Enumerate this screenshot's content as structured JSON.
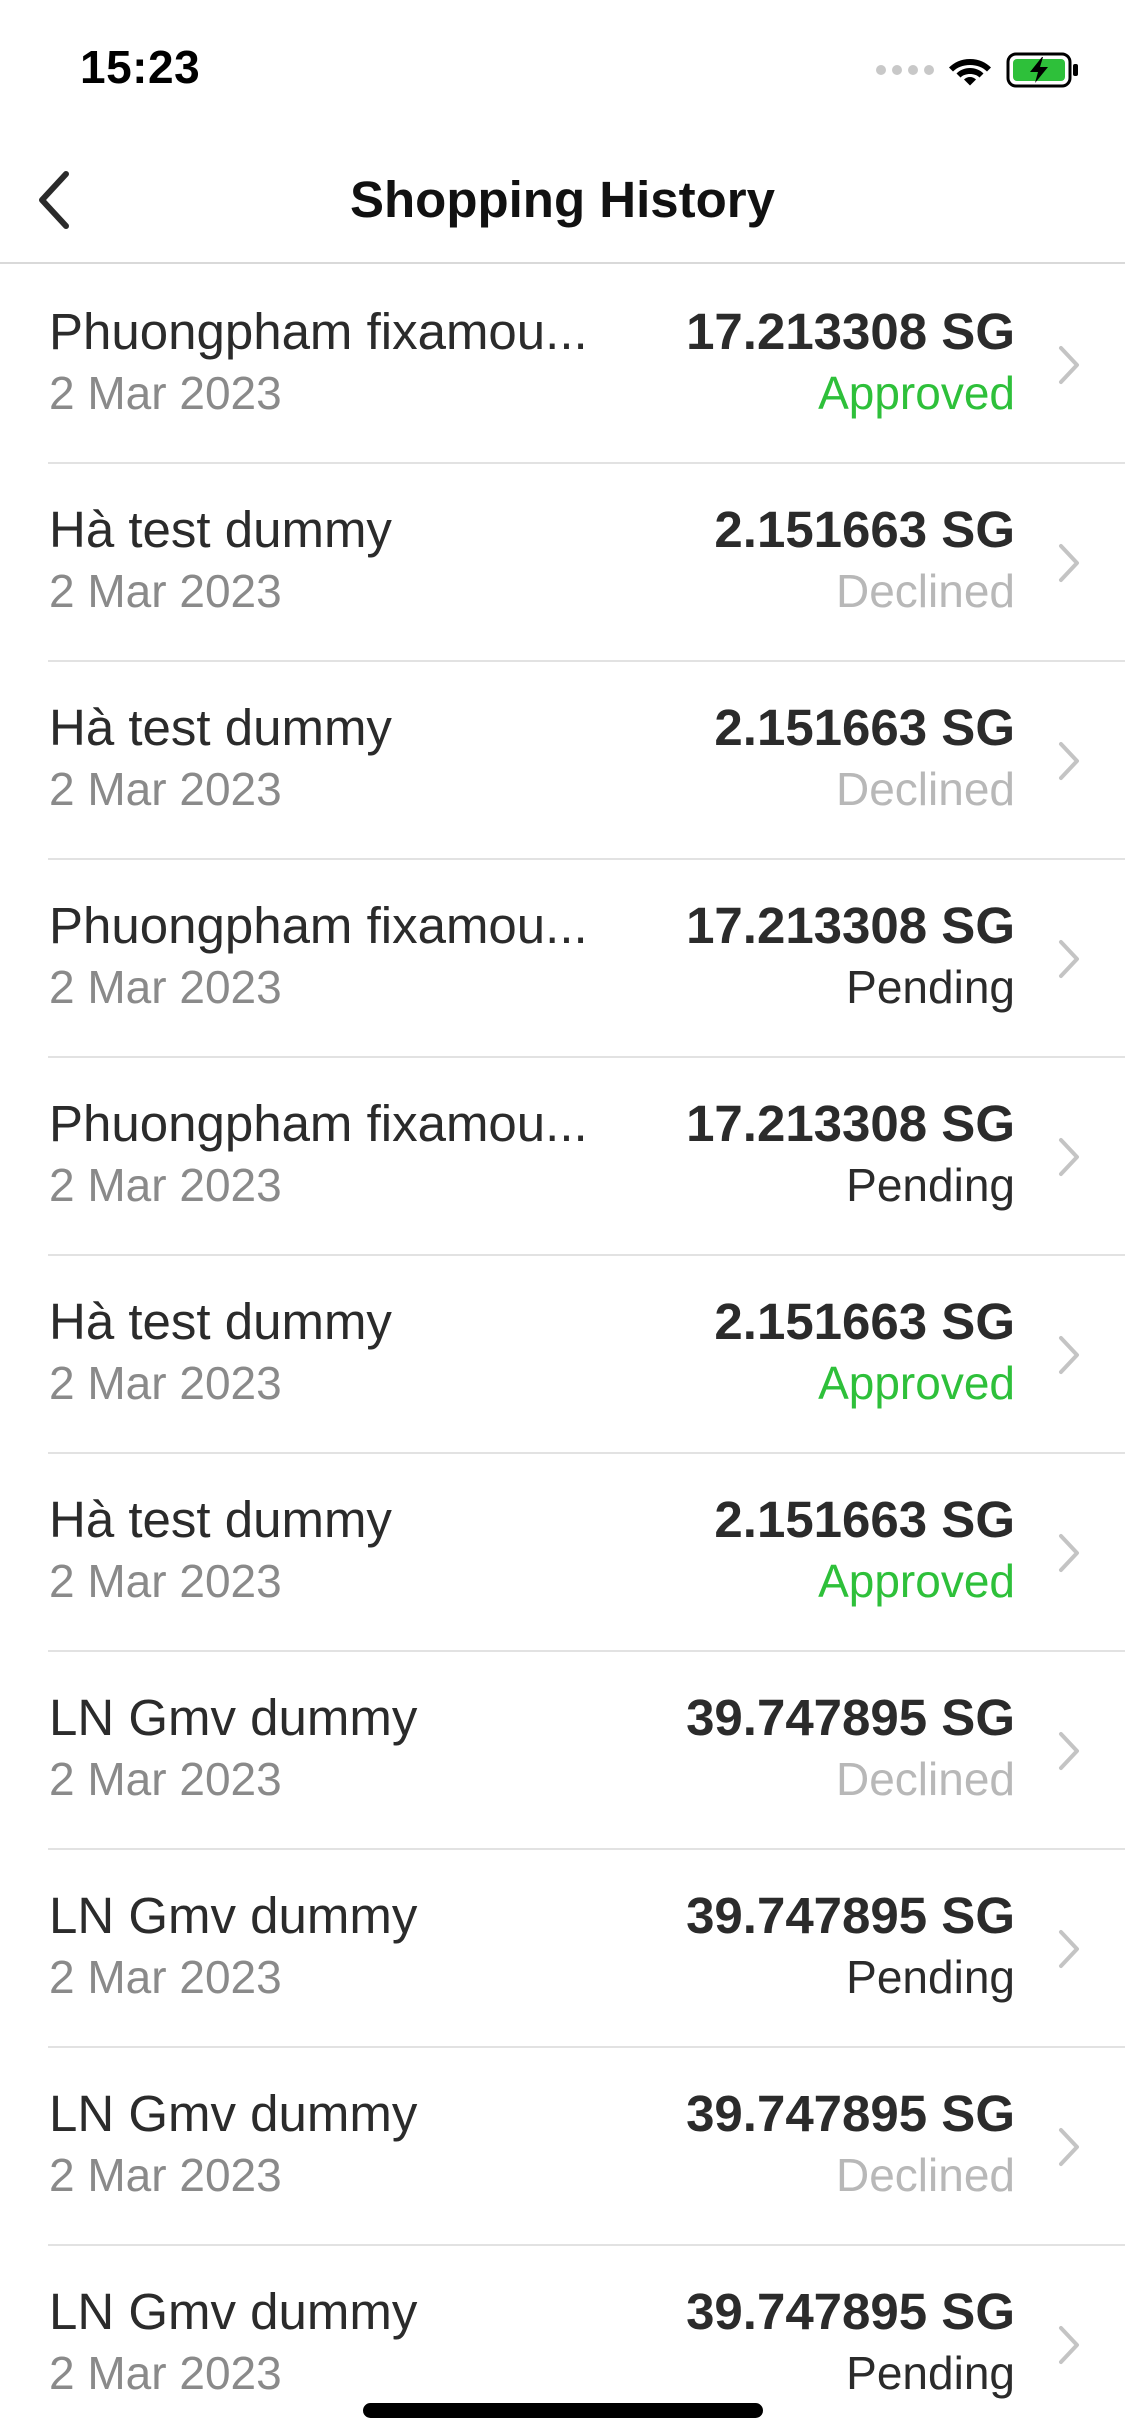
{
  "status_bar": {
    "time": "15:23",
    "icons": [
      "signal-dots-icon",
      "wifi-icon",
      "battery-charging-icon"
    ],
    "battery_color": "#2ec03a"
  },
  "nav": {
    "title": "Shopping History",
    "back_icon": "chevron-left-icon"
  },
  "colors": {
    "approved": "#2ec03a",
    "declined": "#b8b8b8",
    "pending": "#2b2b2b"
  },
  "transactions": [
    {
      "merchant": "Phuongpham fixamou...",
      "date": "2 Mar 2023",
      "amount": "17.213308 SG",
      "status": "Approved"
    },
    {
      "merchant": "Hà test dummy",
      "date": "2 Mar 2023",
      "amount": "2.151663 SG",
      "status": "Declined"
    },
    {
      "merchant": "Hà test dummy",
      "date": "2 Mar 2023",
      "amount": "2.151663 SG",
      "status": "Declined"
    },
    {
      "merchant": "Phuongpham fixamou...",
      "date": "2 Mar 2023",
      "amount": "17.213308 SG",
      "status": "Pending"
    },
    {
      "merchant": "Phuongpham fixamou...",
      "date": "2 Mar 2023",
      "amount": "17.213308 SG",
      "status": "Pending"
    },
    {
      "merchant": "Hà test dummy",
      "date": "2 Mar 2023",
      "amount": "2.151663 SG",
      "status": "Approved"
    },
    {
      "merchant": "Hà test dummy",
      "date": "2 Mar 2023",
      "amount": "2.151663 SG",
      "status": "Approved"
    },
    {
      "merchant": "LN Gmv dummy",
      "date": "2 Mar 2023",
      "amount": "39.747895 SG",
      "status": "Declined"
    },
    {
      "merchant": "LN Gmv dummy",
      "date": "2 Mar 2023",
      "amount": "39.747895 SG",
      "status": "Pending"
    },
    {
      "merchant": "LN Gmv dummy",
      "date": "2 Mar 2023",
      "amount": "39.747895 SG",
      "status": "Declined"
    },
    {
      "merchant": "LN Gmv dummy",
      "date": "2 Mar 2023",
      "amount": "39.747895 SG",
      "status": "Pending"
    }
  ]
}
